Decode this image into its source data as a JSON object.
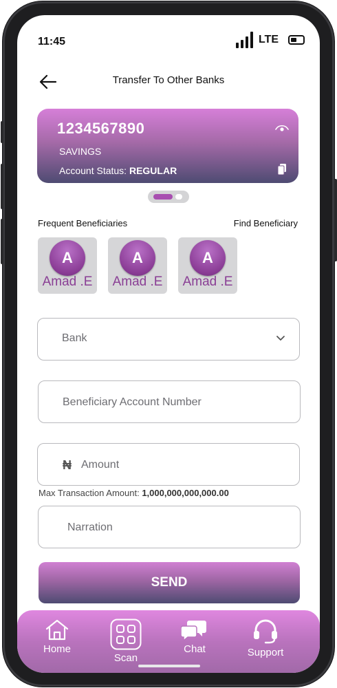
{
  "status": {
    "time": "11:45",
    "network": "LTE"
  },
  "header": {
    "title": "Transfer To Other Banks"
  },
  "account": {
    "number": "1234567890",
    "type": "SAVINGS",
    "status_label": "Account Status:",
    "status_value": "REGULAR"
  },
  "beneficiaries": {
    "frequent_label": "Frequent Beneficiaries",
    "find_label": "Find Beneficiary",
    "items": [
      {
        "initial": "A",
        "name": "Amad .E"
      },
      {
        "initial": "A",
        "name": "Amad .E"
      },
      {
        "initial": "A",
        "name": "Amad .E"
      }
    ]
  },
  "form": {
    "bank_placeholder": "Bank",
    "account_placeholder": "Beneficiary Account Number",
    "currency_symbol": "₦",
    "amount_placeholder": "Amount",
    "max_label": "Max Transaction Amount:",
    "max_value": "1,000,000,000,000.00",
    "narration_placeholder": "Narration",
    "send_label": "SEND"
  },
  "nav": {
    "home": "Home",
    "scan": "Scan",
    "chat": "Chat",
    "support": "Support"
  },
  "colors": {
    "accent": "#a84fb0",
    "card_top": "#d67fd8",
    "card_bottom": "#4e4b72",
    "nav_bg": "#d07fd2"
  }
}
